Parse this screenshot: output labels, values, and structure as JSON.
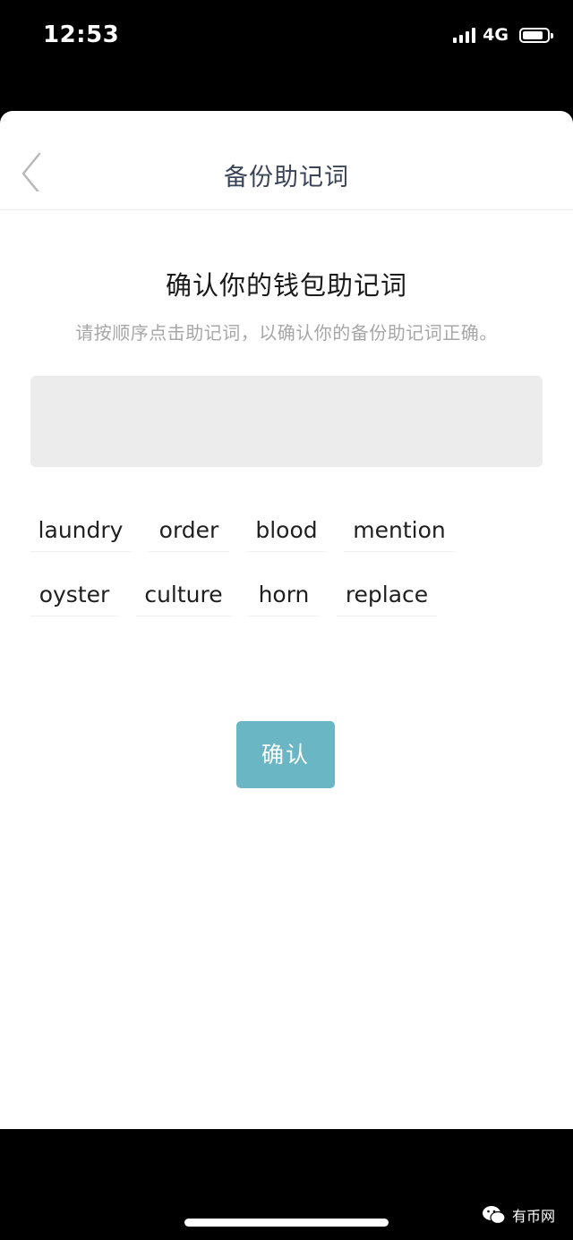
{
  "status_bar": {
    "time": "12:53",
    "network": "4G"
  },
  "nav": {
    "title": "备份助记词"
  },
  "main": {
    "heading": "确认你的钱包助记词",
    "subtext": "请按顺序点击助记词，以确认你的备份助记词正确。",
    "words": [
      "laundry",
      "order",
      "blood",
      "mention",
      "oyster",
      "culture",
      "horn",
      "replace"
    ],
    "confirm_label": "确认"
  },
  "watermark": {
    "text": "有币网"
  },
  "colors": {
    "accent": "#6bb6c4",
    "answer_box": "#ececec",
    "subtext": "#a7a7a7"
  }
}
